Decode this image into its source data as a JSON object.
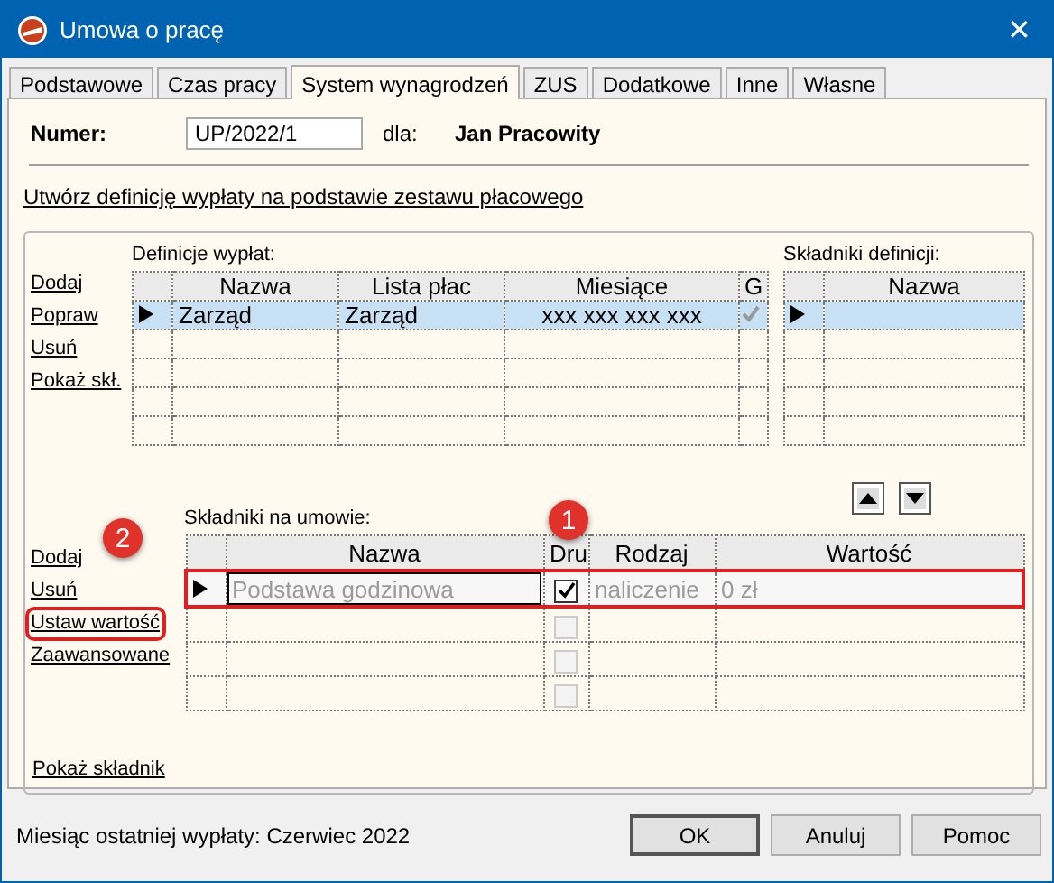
{
  "window": {
    "title": "Umowa o pracę",
    "close": "✕"
  },
  "tabs": [
    {
      "label": "Podstawowe",
      "selected": false
    },
    {
      "label": "Czas pracy",
      "selected": false
    },
    {
      "label": "System wynagrodzeń",
      "selected": true
    },
    {
      "label": "ZUS",
      "selected": false
    },
    {
      "label": "Dodatkowe",
      "selected": false
    },
    {
      "label": "Inne",
      "selected": false
    },
    {
      "label": "Własne",
      "selected": false
    }
  ],
  "header": {
    "number_label": "Numer:",
    "number_value": "UP/2022/1",
    "for_label": "dla:",
    "employee": "Jan Pracowity"
  },
  "create_link": "Utwórz definicję wypłaty na podstawie zestawu płacowego",
  "definitions": {
    "label": "Definicje wypłat:",
    "actions": [
      {
        "label": "Dodaj"
      },
      {
        "label": "Popraw"
      },
      {
        "label": "Usuń"
      },
      {
        "label": "Pokaż skł."
      }
    ],
    "columns": [
      "Nazwa",
      "Lista płac",
      "Miesiące",
      "G"
    ],
    "rows": [
      {
        "nazwa": "Zarząd",
        "lista": "Zarząd",
        "miesiace": "xxx xxx xxx xxx",
        "g_checked": true,
        "selected": true
      }
    ]
  },
  "definition_components": {
    "label": "Składniki definicji:",
    "columns": [
      "Nazwa"
    ],
    "rows": [
      {
        "selected": true
      }
    ]
  },
  "contract_components": {
    "label": "Składniki na umowie:",
    "actions": [
      {
        "label": "Dodaj"
      },
      {
        "label": "Usuń"
      },
      {
        "label": "Ustaw wartość",
        "callout": "2"
      },
      {
        "label": "Zaawansowane"
      }
    ],
    "columns": [
      "Nazwa",
      "Dru",
      "Rodzaj",
      "Wartość"
    ],
    "rows": [
      {
        "nazwa": "Podstawa godzinowa",
        "druk": true,
        "rodzaj": "naliczenie",
        "wartosc": "0 zł",
        "selected": true,
        "callout": "1"
      },
      {
        "druk": false,
        "selected": false
      },
      {
        "druk": false,
        "selected": false
      },
      {
        "druk": false,
        "selected": false
      }
    ],
    "show_link": "Pokaż składnik"
  },
  "status": "Miesiąc ostatniej wypłaty: Czerwiec 2022",
  "buttons": [
    {
      "label": "OK",
      "default": true
    },
    {
      "label": "Anuluj",
      "default": false
    },
    {
      "label": "Pomoc",
      "default": false
    }
  ]
}
